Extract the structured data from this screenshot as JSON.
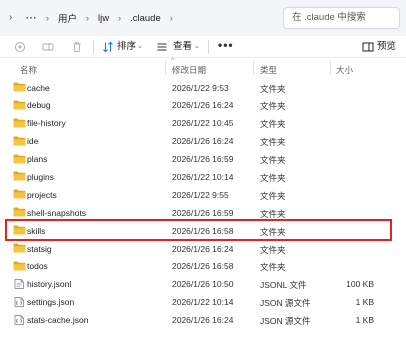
{
  "address_bar": {
    "more_label": "···",
    "breadcrumbs": [
      "用户",
      "ljw",
      ".claude"
    ],
    "search_placeholder": "在 .claude 中搜索"
  },
  "command_bar": {
    "sort_label": "排序",
    "view_label": "查看",
    "more_label": "•••",
    "preview_label": "预览"
  },
  "columns": {
    "name": "名称",
    "date": "修改日期",
    "type": "类型",
    "size": "大小"
  },
  "files": [
    {
      "name": "cache",
      "date": "2026/1/22 9:53",
      "type": "文件夹",
      "size": "",
      "kind": "folder"
    },
    {
      "name": "debug",
      "date": "2026/1/26 16:24",
      "type": "文件夹",
      "size": "",
      "kind": "folder"
    },
    {
      "name": "file-history",
      "date": "2026/1/22 10:45",
      "type": "文件夹",
      "size": "",
      "kind": "folder"
    },
    {
      "name": "ide",
      "date": "2026/1/26 16:24",
      "type": "文件夹",
      "size": "",
      "kind": "folder"
    },
    {
      "name": "plans",
      "date": "2026/1/26 16:59",
      "type": "文件夹",
      "size": "",
      "kind": "folder"
    },
    {
      "name": "plugins",
      "date": "2026/1/22 10:14",
      "type": "文件夹",
      "size": "",
      "kind": "folder"
    },
    {
      "name": "projects",
      "date": "2026/1/22 9:55",
      "type": "文件夹",
      "size": "",
      "kind": "folder"
    },
    {
      "name": "shell-snapshots",
      "date": "2026/1/26 16:59",
      "type": "文件夹",
      "size": "",
      "kind": "folder"
    },
    {
      "name": "skills",
      "date": "2026/1/26 16:58",
      "type": "文件夹",
      "size": "",
      "kind": "folder"
    },
    {
      "name": "statsig",
      "date": "2026/1/26 16:24",
      "type": "文件夹",
      "size": "",
      "kind": "folder"
    },
    {
      "name": "todos",
      "date": "2026/1/26 16:58",
      "type": "文件夹",
      "size": "",
      "kind": "folder"
    },
    {
      "name": "history.jsonl",
      "date": "2026/1/26 10:50",
      "type": "JSONL 文件",
      "size": "100 KB",
      "kind": "file"
    },
    {
      "name": "settings.json",
      "date": "2026/1/22 10:14",
      "type": "JSON 源文件",
      "size": "1 KB",
      "kind": "json"
    },
    {
      "name": "stats-cache.json",
      "date": "2026/1/26 16:24",
      "type": "JSON 源文件",
      "size": "1 KB",
      "kind": "json"
    }
  ],
  "colors": {
    "folder": "#f4c542",
    "folder_dark": "#e0a91e",
    "highlight": "#e02424",
    "accent": "#1a73e8"
  }
}
